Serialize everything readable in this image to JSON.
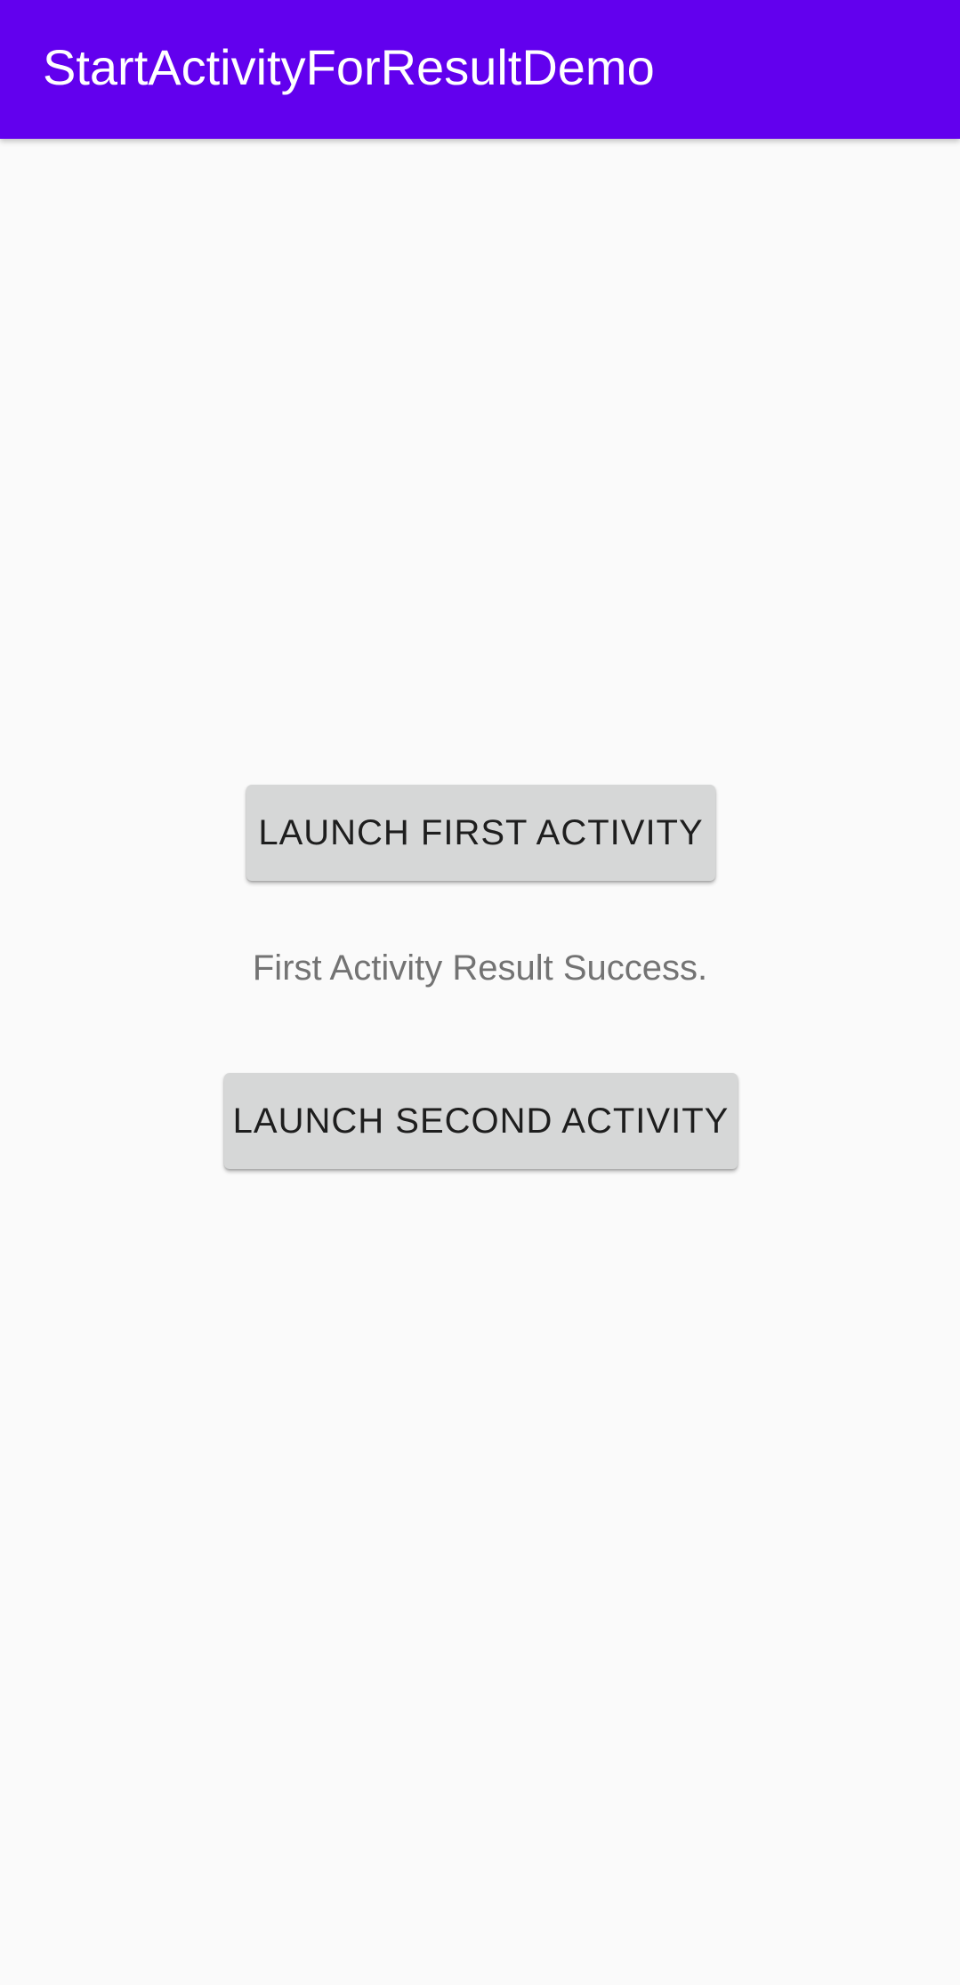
{
  "app_bar": {
    "title": "StartActivityForResultDemo",
    "color": "#6200ee"
  },
  "main": {
    "first_button_label": "LAUNCH FIRST ACTIVITY",
    "result_text": "First Activity Result Success.",
    "second_button_label": "LAUNCH SECOND ACTIVITY"
  }
}
